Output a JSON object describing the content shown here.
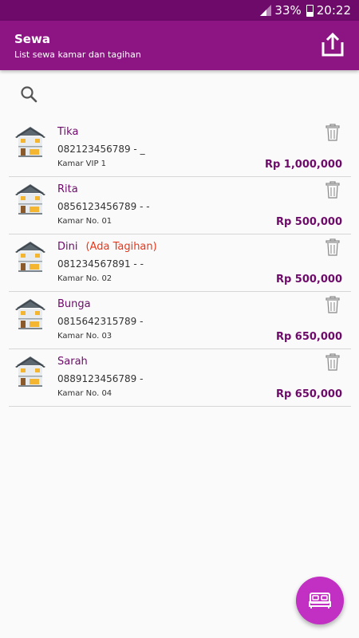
{
  "status_bar": {
    "battery": "33%",
    "time": "20:22",
    "signal_icon": "signal-icon",
    "battery_icon": "battery-icon"
  },
  "app_bar": {
    "title": "Sewa",
    "subtitle": "List sewa kamar dan tagihan",
    "share_icon": "share-icon"
  },
  "search": {
    "icon": "search-icon"
  },
  "tenants": [
    {
      "name": "Tika",
      "tag": "",
      "phone": "082123456789 - _",
      "room": "Kamar VIP 1",
      "price": "Rp 1,000,000"
    },
    {
      "name": "Rita",
      "tag": "",
      "phone": "0856123456789 - -",
      "room": "Kamar No. 01",
      "price": "Rp 500,000"
    },
    {
      "name": "Dini",
      "tag": "(Ada Tagihan)",
      "phone": "081234567891 - -",
      "room": "Kamar No. 02",
      "price": "Rp 500,000"
    },
    {
      "name": "Bunga",
      "tag": "",
      "phone": "0815642315789 -",
      "room": "Kamar No. 03",
      "price": "Rp 650,000"
    },
    {
      "name": "Sarah",
      "tag": "",
      "phone": "0889123456789 -",
      "room": "Kamar No. 04",
      "price": "Rp 650,000"
    }
  ],
  "fab": {
    "icon": "bed-icon"
  },
  "colors": {
    "status_bar": "#6e0a6a",
    "app_bar": "#8c1583",
    "accent_text": "#6e0a6a",
    "tag": "#e8361a",
    "fab": "#c22fc3"
  }
}
